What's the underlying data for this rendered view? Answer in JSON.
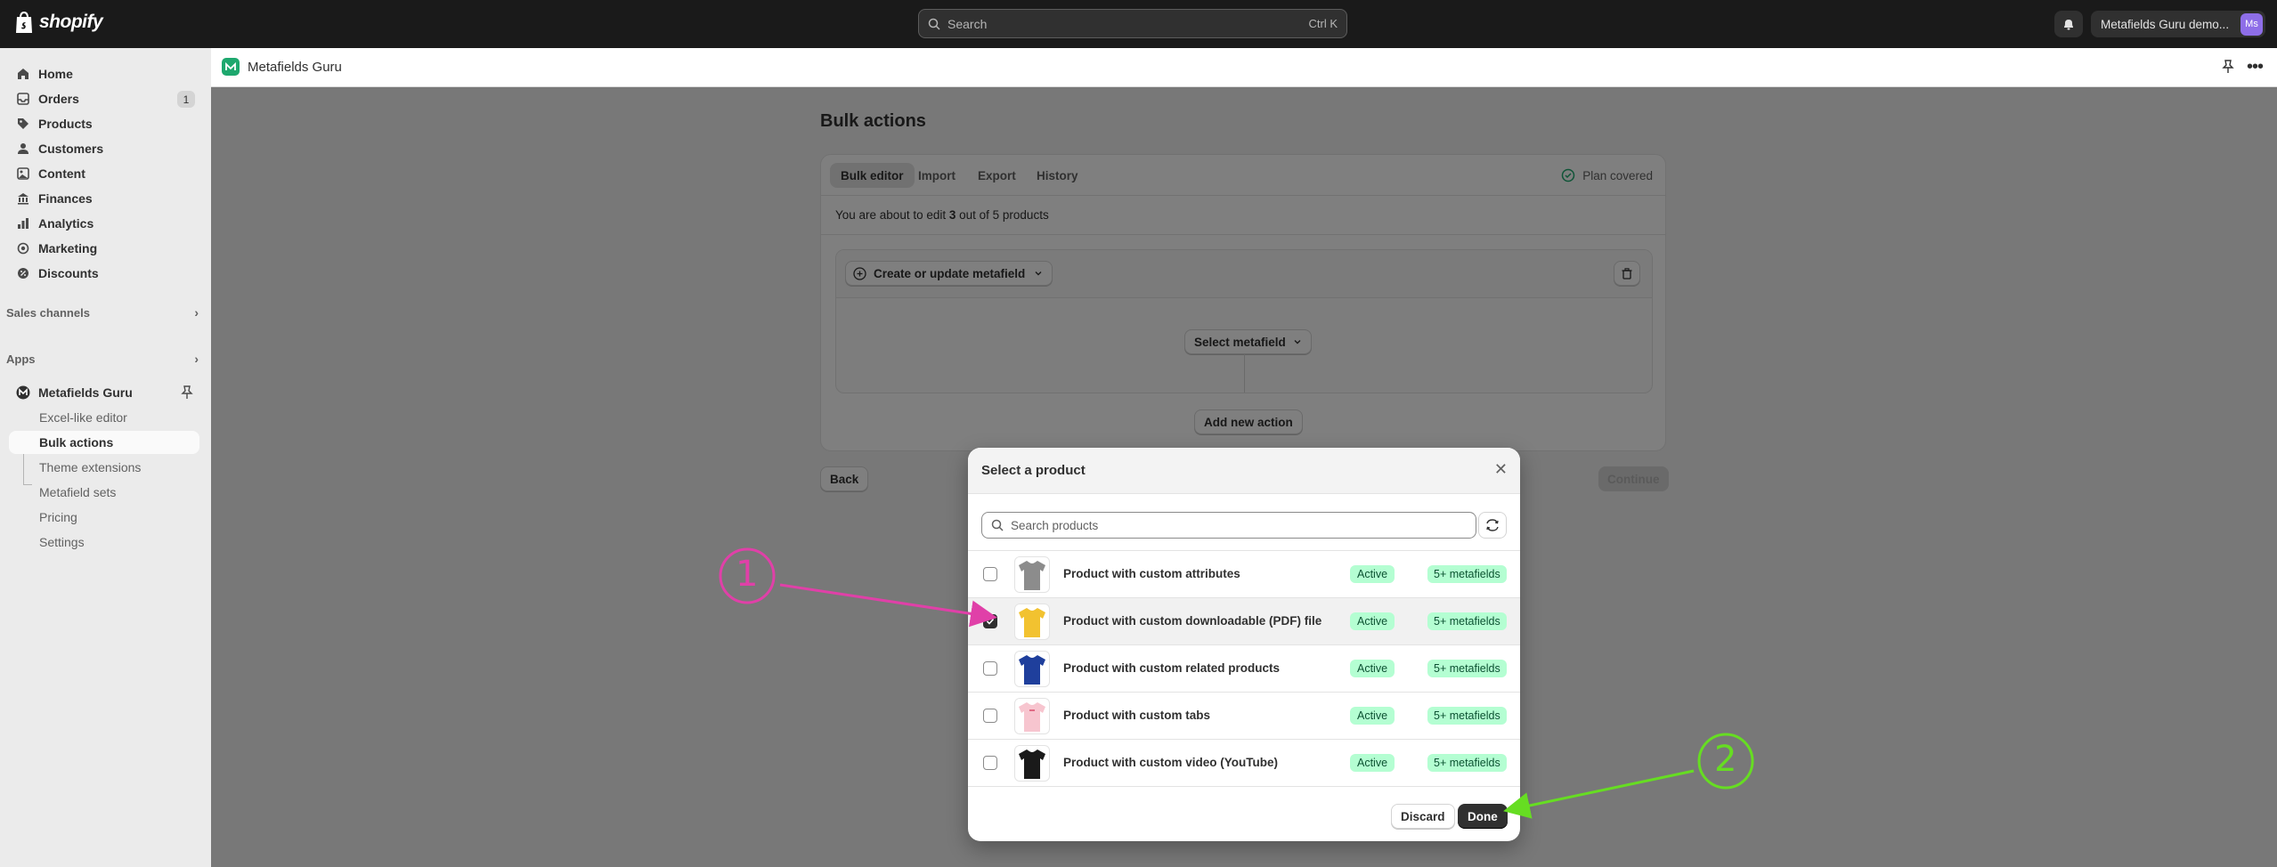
{
  "topbar": {
    "brand": "shopify",
    "search_placeholder": "Search",
    "search_shortcut": "Ctrl K",
    "store_name": "Metafields Guru demo...",
    "avatar_initials": "Ms"
  },
  "sidebar": {
    "items": [
      {
        "label": "Home",
        "icon": "home-icon"
      },
      {
        "label": "Orders",
        "icon": "inbox-icon",
        "badge": "1"
      },
      {
        "label": "Products",
        "icon": "tag-icon"
      },
      {
        "label": "Customers",
        "icon": "person-icon"
      },
      {
        "label": "Content",
        "icon": "content-icon"
      },
      {
        "label": "Finances",
        "icon": "bank-icon"
      },
      {
        "label": "Analytics",
        "icon": "chart-icon"
      },
      {
        "label": "Marketing",
        "icon": "target-icon"
      },
      {
        "label": "Discounts",
        "icon": "discount-icon"
      }
    ],
    "sales_channels": "Sales channels",
    "apps": "Apps",
    "app_name": "Metafields Guru",
    "app_items": [
      "Excel-like editor",
      "Bulk actions",
      "Theme extensions",
      "Metafield sets",
      "Pricing",
      "Settings"
    ]
  },
  "app_header": {
    "title": "Metafields Guru"
  },
  "main": {
    "page_title": "Bulk actions",
    "tabs": [
      "Bulk editor",
      "Import",
      "Export",
      "History"
    ],
    "plan_status": "Plan covered",
    "info_prefix": "You are about to edit ",
    "info_count": "3",
    "info_suffix": " out of 5 products",
    "create_button": "Create or update metafield",
    "select_metafield": "Select metafield",
    "add_new_action": "Add new action",
    "back": "Back",
    "continue": "Continue"
  },
  "modal": {
    "title": "Select a product",
    "search_placeholder": "Search products",
    "products": [
      {
        "name": "Product with custom attributes",
        "status": "Active",
        "metafields": "5+ metafields",
        "checked": false,
        "color": "#8c8c8c"
      },
      {
        "name": "Product with custom downloadable (PDF) file",
        "status": "Active",
        "metafields": "5+ metafields",
        "checked": true,
        "color": "#f2c230"
      },
      {
        "name": "Product with custom related products",
        "status": "Active",
        "metafields": "5+ metafields",
        "checked": false,
        "color": "#1f3f9c"
      },
      {
        "name": "Product with custom tabs",
        "status": "Active",
        "metafields": "5+ metafields",
        "checked": false,
        "color": "#f7c5cf"
      },
      {
        "name": "Product with custom video (YouTube)",
        "status": "Active",
        "metafields": "5+ metafields",
        "checked": false,
        "color": "#1a1a1a"
      }
    ],
    "discard": "Discard",
    "done": "Done"
  },
  "annotations": {
    "step1": "1",
    "step2": "2",
    "step1_color": "#e040a8",
    "step2_color": "#66dd22"
  }
}
